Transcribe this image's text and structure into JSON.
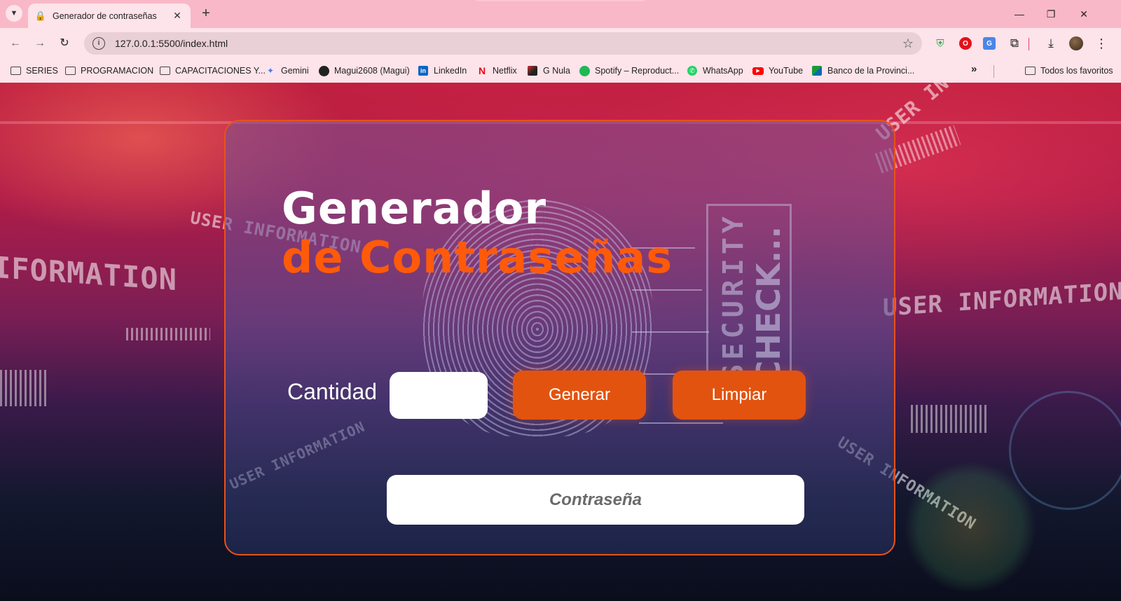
{
  "browser": {
    "tab": {
      "title": "Generador de contraseñas",
      "favicon": "lock-icon"
    },
    "address": {
      "url": "127.0.0.1:5500/index.html"
    },
    "bookmarks": [
      {
        "label": "SERIES",
        "icon": "folder-icon"
      },
      {
        "label": "PROGRAMACION",
        "icon": "folder-icon"
      },
      {
        "label": "CAPACITACIONES Y...",
        "icon": "folder-icon"
      },
      {
        "label": "Gemini",
        "icon": "gemini-icon"
      },
      {
        "label": "Magui2608 (Magui)",
        "icon": "github-icon"
      },
      {
        "label": "LinkedIn",
        "icon": "linkedin-icon"
      },
      {
        "label": "Netflix",
        "icon": "netflix-icon"
      },
      {
        "label": "G Nula",
        "icon": "gnula-icon"
      },
      {
        "label": "Spotify – Reproduct...",
        "icon": "spotify-icon"
      },
      {
        "label": "WhatsApp",
        "icon": "whatsapp-icon"
      },
      {
        "label": "YouTube",
        "icon": "youtube-icon"
      },
      {
        "label": "Banco de la Provinci...",
        "icon": "banco-provincia-icon"
      }
    ],
    "all_bookmarks": "Todos los favoritos"
  },
  "page": {
    "title_line1": "Generador",
    "title_line2": "de Contraseñas",
    "quantity_label": "Cantidad",
    "quantity_value": "",
    "generate_button": "Generar",
    "clear_button": "Limpiar",
    "password_placeholder": "Contraseña",
    "password_value": ""
  },
  "colors": {
    "accent_orange": "#ff5a0a",
    "button_orange": "#e2530f",
    "card_border": "#e8521a",
    "browser_pink": "#f9b8c7"
  }
}
